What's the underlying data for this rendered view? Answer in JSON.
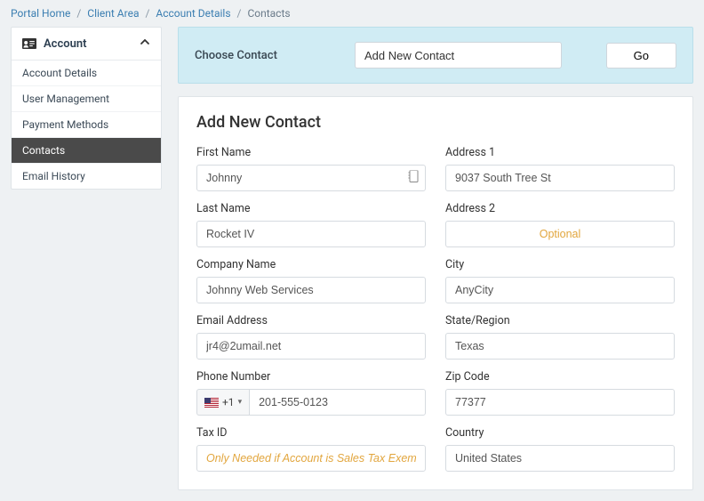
{
  "breadcrumbs": {
    "items": [
      "Portal Home",
      "Client Area",
      "Account Details"
    ],
    "current": "Contacts"
  },
  "sidebar": {
    "title": "Account",
    "items": [
      {
        "label": "Account Details"
      },
      {
        "label": "User Management"
      },
      {
        "label": "Payment Methods"
      },
      {
        "label": "Contacts",
        "active": true
      },
      {
        "label": "Email History"
      }
    ]
  },
  "choose_contact": {
    "label": "Choose Contact",
    "selected": "Add New Contact",
    "go_label": "Go"
  },
  "form": {
    "title": "Add New Contact",
    "first_name": {
      "label": "First Name",
      "value": "Johnny"
    },
    "last_name": {
      "label": "Last Name",
      "value": "Rocket IV"
    },
    "company": {
      "label": "Company Name",
      "value": "Johnny Web Services"
    },
    "email": {
      "label": "Email Address",
      "value": "jr4@2umail.net"
    },
    "phone": {
      "label": "Phone Number",
      "prefix": "+1",
      "value": "201-555-0123"
    },
    "tax_id": {
      "label": "Tax ID",
      "placeholder": "Only Needed if Account is Sales Tax Exempt"
    },
    "address1": {
      "label": "Address 1",
      "value": "9037 South Tree St"
    },
    "address2": {
      "label": "Address 2",
      "placeholder": "Optional"
    },
    "city": {
      "label": "City",
      "value": "AnyCity"
    },
    "state": {
      "label": "State/Region",
      "value": "Texas"
    },
    "zip": {
      "label": "Zip Code",
      "value": "77377"
    },
    "country": {
      "label": "Country",
      "value": "United States"
    }
  }
}
